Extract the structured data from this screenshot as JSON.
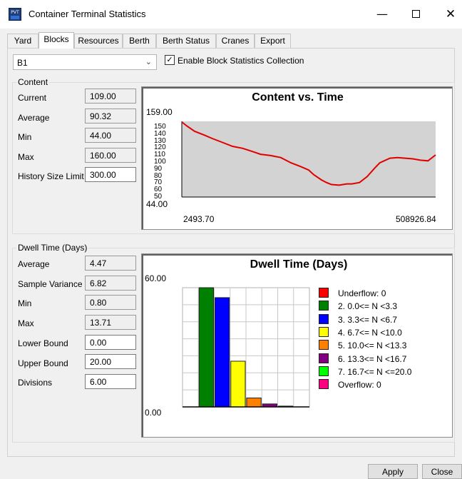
{
  "window": {
    "title": "Container Terminal Statistics",
    "icon": "app-logo-icon"
  },
  "tabs": [
    {
      "label": "Yard"
    },
    {
      "label": "Blocks",
      "active": true
    },
    {
      "label": "Resources"
    },
    {
      "label": "Berth"
    },
    {
      "label": "Berth Status"
    },
    {
      "label": "Cranes"
    },
    {
      "label": "Export"
    }
  ],
  "block_select": {
    "value": "B1"
  },
  "enable_stats": {
    "label": "Enable Block Statistics Collection",
    "checked": true
  },
  "content": {
    "group_label": "Content",
    "fields": [
      {
        "label": "Current",
        "value": "109.00"
      },
      {
        "label": "Average",
        "value": "90.32"
      },
      {
        "label": "Min",
        "value": "44.00"
      },
      {
        "label": "Max",
        "value": "160.00"
      },
      {
        "label": "History Size Limit",
        "value": "300.00"
      }
    ],
    "chart": {
      "title": "Content vs. Time",
      "y_max_label": "159.00",
      "y_min_label": "44.00",
      "x_min_label": "2493.70",
      "x_max_label": "508926.84",
      "y_ticks": [
        "150",
        "140",
        "130",
        "120",
        "110",
        "100",
        "90",
        "80",
        "70",
        "60",
        "50"
      ]
    }
  },
  "dwell": {
    "group_label": "Dwell Time (Days)",
    "fields": [
      {
        "label": "Average",
        "value": "4.47"
      },
      {
        "label": "Sample Variance",
        "value": "6.82"
      },
      {
        "label": "Min",
        "value": "0.80"
      },
      {
        "label": "Max",
        "value": "13.71"
      },
      {
        "label": "Lower Bound",
        "value": "0.00"
      },
      {
        "label": "Upper Bound",
        "value": "20.00"
      },
      {
        "label": "Divisions",
        "value": "6.00"
      }
    ],
    "chart": {
      "title": "Dwell Time (Days)",
      "y_max_label": "60.00",
      "y_min_label": "0.00",
      "legend": [
        {
          "label": "Underflow: 0",
          "color": "#ff0000"
        },
        {
          "label": "2. 0.0<= N <3.3",
          "color": "#008000"
        },
        {
          "label": "3. 3.3<= N <6.7",
          "color": "#0000ff"
        },
        {
          "label": "4. 6.7<= N <10.0",
          "color": "#ffff00"
        },
        {
          "label": "5. 10.0<= N <13.3",
          "color": "#ff8000"
        },
        {
          "label": "6. 13.3<= N <16.7",
          "color": "#800080"
        },
        {
          "label": "7. 16.7<= N <=20.0",
          "color": "#00ff00"
        },
        {
          "label": "Overflow: 0",
          "color": "#ff0080"
        }
      ]
    }
  },
  "chart_data": [
    {
      "type": "line",
      "title": "Content vs. Time",
      "xlim": [
        2493.7,
        508926.84
      ],
      "ylim": [
        44.0,
        159.0
      ],
      "y_ticks": [
        150,
        140,
        130,
        120,
        110,
        100,
        90,
        80,
        70,
        60,
        50
      ],
      "series": [
        {
          "color": "#e00000",
          "x": [
            0,
            0.02,
            0.05,
            0.09,
            0.12,
            0.16,
            0.2,
            0.24,
            0.28,
            0.31,
            0.35,
            0.39,
            0.43,
            0.47,
            0.5,
            0.52,
            0.55,
            0.57,
            0.59,
            0.62,
            0.65,
            0.67,
            0.7,
            0.73,
            0.76,
            0.78,
            0.82,
            0.85,
            0.88,
            0.91,
            0.94,
            0.97,
            1.0
          ],
          "y": [
            158,
            152,
            144,
            138,
            133,
            127,
            121,
            118,
            113,
            109,
            107,
            104,
            96,
            90,
            85,
            78,
            70,
            66,
            63,
            62,
            64,
            64,
            66,
            75,
            88,
            96,
            103,
            104,
            103,
            102,
            100,
            99,
            108
          ]
        }
      ],
      "grid": false
    },
    {
      "type": "bar",
      "title": "Dwell Time (Days)",
      "ylim": [
        0,
        60
      ],
      "categories": [
        "Underflow",
        "0.0<= N <3.3",
        "3.3<= N <6.7",
        "6.7<= N <10.0",
        "10.0<= N <13.3",
        "13.3<= N <16.7",
        "16.7<= N <=20.0",
        "Overflow"
      ],
      "values": [
        0,
        60,
        55,
        23,
        4.5,
        1.5,
        0.4,
        0
      ],
      "colors": [
        "#ff0000",
        "#008000",
        "#0000ff",
        "#ffff00",
        "#ff8000",
        "#800080",
        "#00ff00",
        "#ff0080"
      ],
      "grid": true
    }
  ],
  "buttons": {
    "apply": "Apply",
    "close": "Close"
  }
}
